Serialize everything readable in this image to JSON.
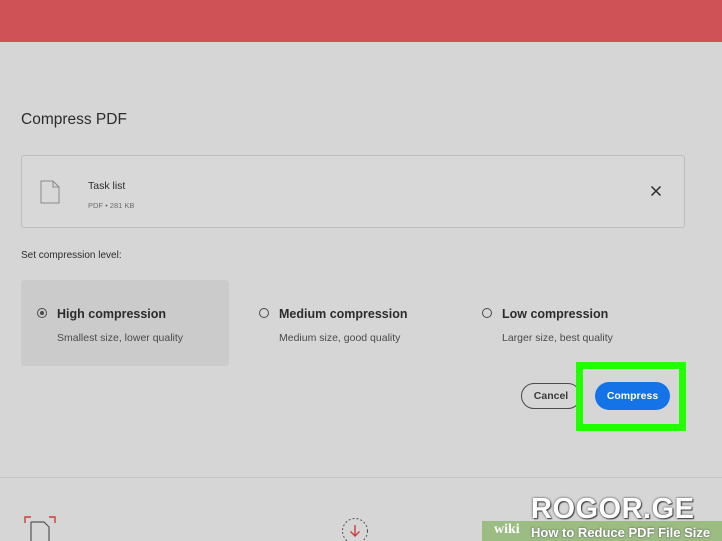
{
  "dialog": {
    "title": "Compress PDF"
  },
  "file": {
    "name": "Task list",
    "meta": "PDF • 281 KB",
    "icon": "document-icon",
    "remove_icon": "close-icon"
  },
  "compression": {
    "label": "Set compression level:",
    "options": [
      {
        "title": "High compression",
        "subtitle": "Smallest size, lower quality",
        "selected": true
      },
      {
        "title": "Medium compression",
        "subtitle": "Medium size, good quality",
        "selected": false
      },
      {
        "title": "Low compression",
        "subtitle": "Larger size, best quality",
        "selected": false
      }
    ]
  },
  "actions": {
    "cancel_label": "Cancel",
    "compress_label": "Compress"
  },
  "bottom_bar": {
    "icons": [
      "document-icon",
      "download-icon"
    ]
  },
  "watermark": {
    "wiki": "wiki",
    "caption": "How to Reduce PDF File Size",
    "brand": "ROGOR.GE"
  },
  "colors": {
    "topbar": "#cf5256",
    "primary_button": "#1473e6",
    "highlight": "#22ff00",
    "background": "#d6d6d6"
  }
}
